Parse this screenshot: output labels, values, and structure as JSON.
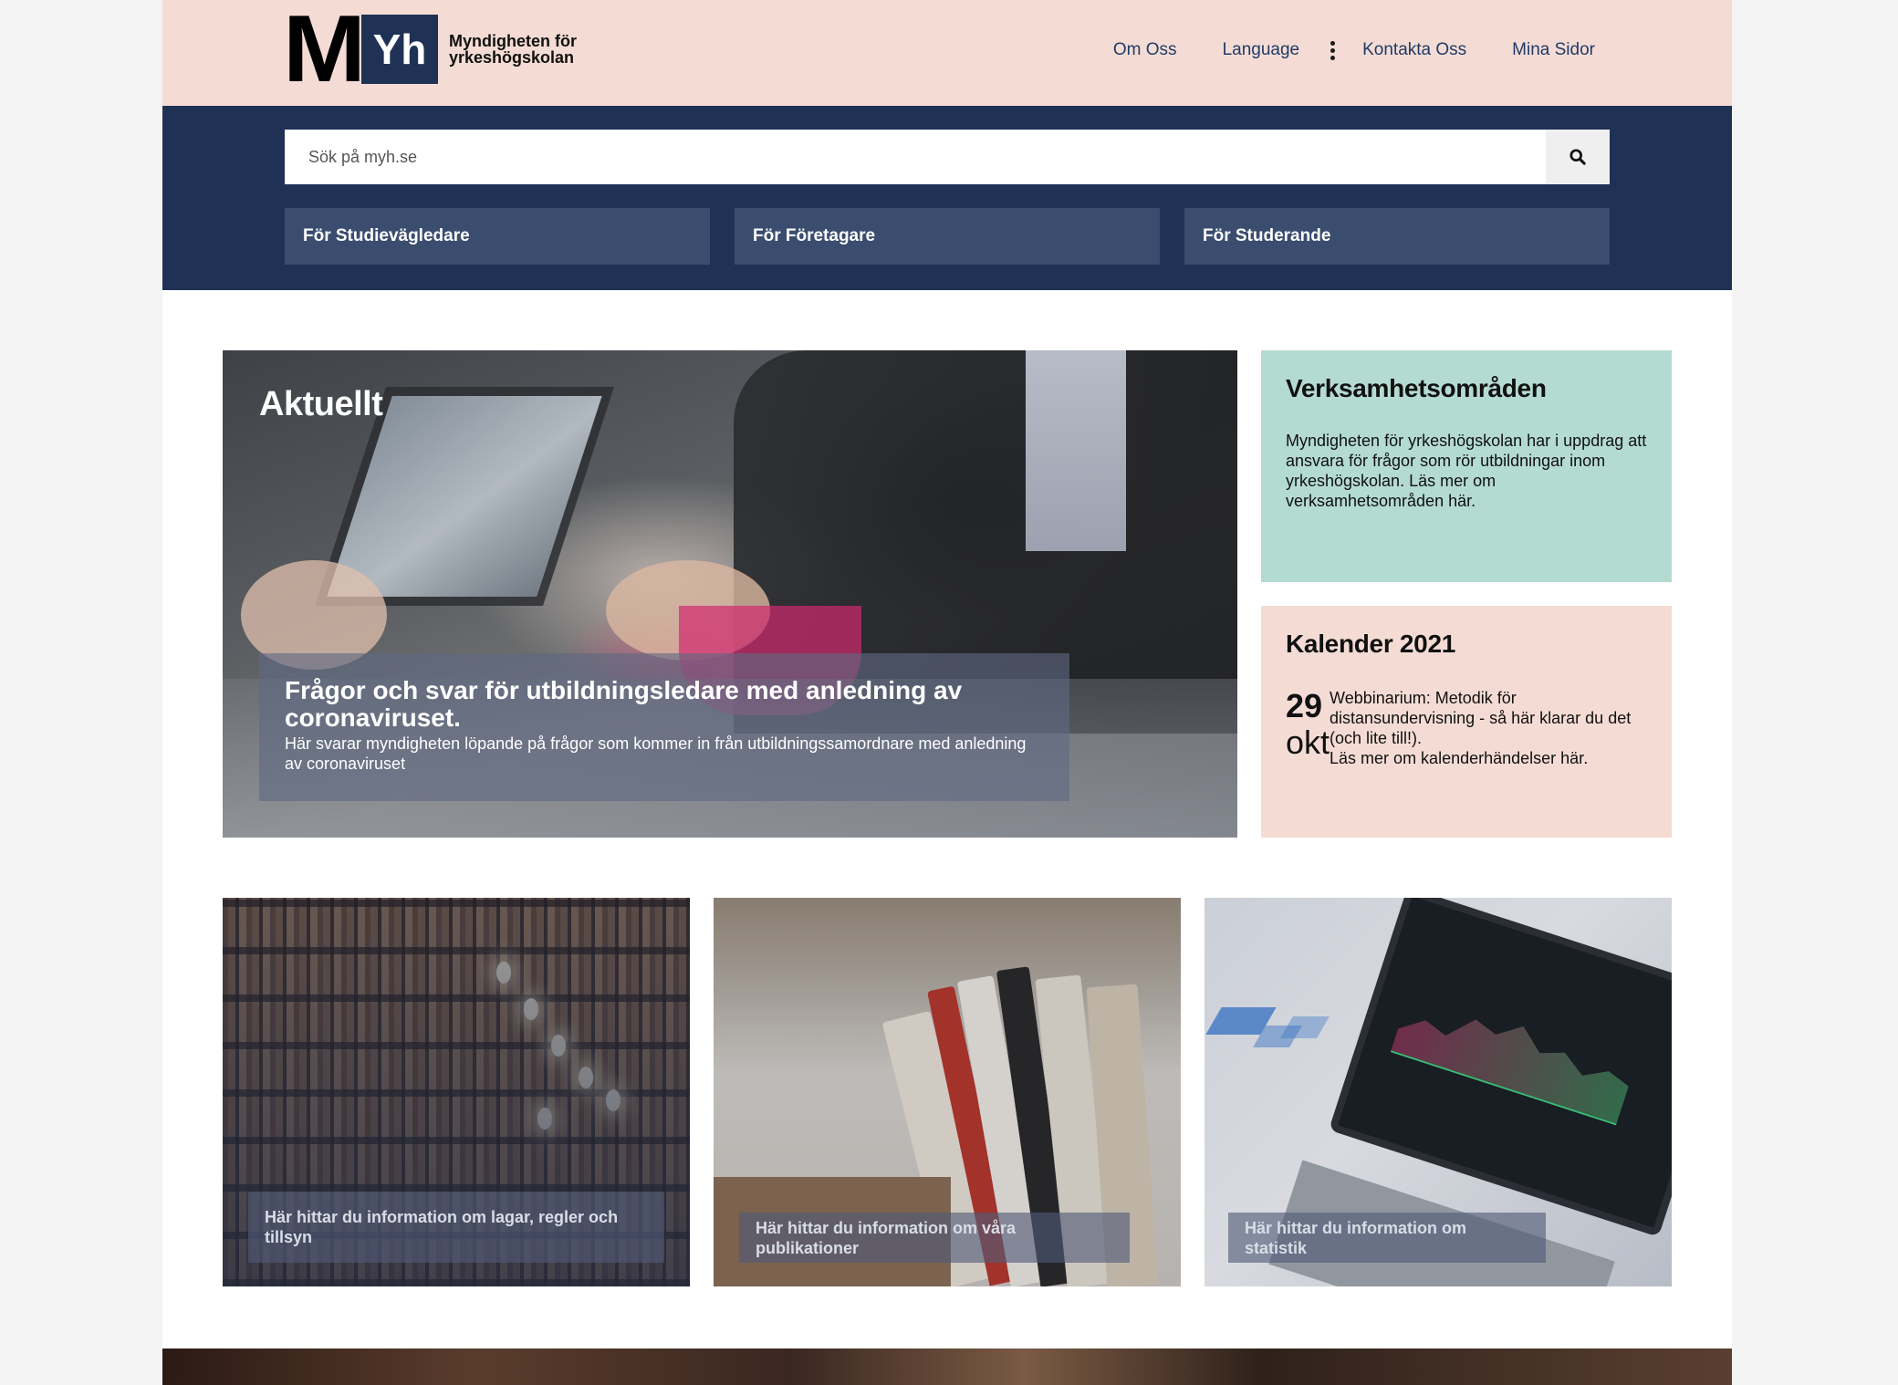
{
  "header": {
    "logo": {
      "m": "M",
      "yh": "Yh",
      "text": "Myndigheten för yrkeshögskolan"
    },
    "nav": [
      {
        "label": "Om Oss"
      },
      {
        "label": "Language"
      },
      {
        "label": "Kontakta Oss"
      },
      {
        "label": "Mina Sidor"
      }
    ]
  },
  "search": {
    "placeholder": "Sök på myh.se",
    "value": ""
  },
  "audiences": [
    {
      "label": "För Studievägledare"
    },
    {
      "label": "För Företagare"
    },
    {
      "label": "För Studerande"
    }
  ],
  "hero": {
    "title": "Aktuellt",
    "headline": "Frågor och svar för utbildningsledare med anledning av coronaviruset.",
    "text": "Här svarar myndigheten löpande på frågor som kommer in från utbildningssamordnare med anledning av coronaviruset"
  },
  "verksamhet": {
    "title": "Verksamhetsområden",
    "text": "Myndigheten för yrkeshögskolan har i uppdrag att ansvara för frågor som rör utbildningar inom yrkeshögskolan. Läs mer om verksamhetsområden här."
  },
  "kalender": {
    "title": "Kalender 2021",
    "day": "29",
    "month": "okt",
    "event": "Webbinarium: Metodik för distansundervisning - så här klarar du det (och lite till!).",
    "more": "Läs mer om kalenderhändelser här."
  },
  "tiles": [
    {
      "label": "Här hittar du information om lagar, regler och tillsyn"
    },
    {
      "label": "Här hittar du information om våra publikationer"
    },
    {
      "label": "Här hittar du information om statistik"
    }
  ],
  "colors": {
    "header_bg": "#f4dcd4",
    "navy": "#1f3256",
    "audience_bg": "#3a4d6f",
    "mint": "#b4dbd1",
    "link": "#1f3b67"
  },
  "icons": {
    "search": "search-icon",
    "more": "kebab-icon"
  }
}
